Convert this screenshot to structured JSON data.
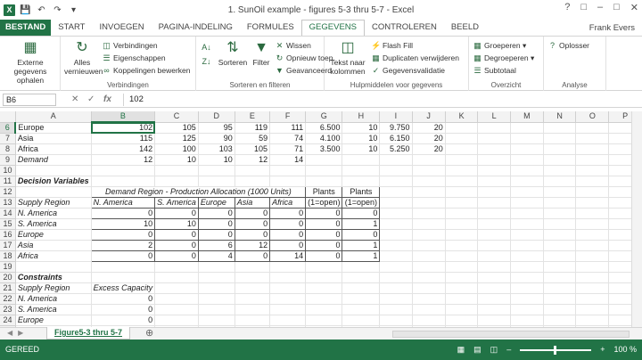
{
  "window": {
    "title": "1. SunOil example - figures 5-3 thru 5-7 - Excel",
    "app_icon": "X",
    "user": "Frank Evers",
    "colors": {
      "brand": "#217346"
    }
  },
  "ribbon_tabs": [
    "BESTAND",
    "START",
    "INVOEGEN",
    "PAGINA-INDELING",
    "FORMULES",
    "GEGEVENS",
    "CONTROLEREN",
    "BEELD"
  ],
  "ribbon": {
    "external_data": "Externe gegevens ophalen",
    "refresh_all": "Alles vernieuwen",
    "connections": "Verbindingen",
    "properties": "Eigenschappen",
    "edit_links": "Koppelingen bewerken",
    "group_connections": "Verbindingen",
    "sort": "Sorteren",
    "filter": "Filter",
    "clear": "Wissen",
    "reapply": "Opnieuw toep.",
    "advanced": "Geavanceerd",
    "group_sort": "Sorteren en filteren",
    "text_to_columns": "Tekst naar kolommen",
    "flash_fill": "Flash Fill",
    "remove_duplicates": "Duplicaten verwijderen",
    "data_validation": "Gegevensvalidatie",
    "group_tools": "Hulpmiddelen voor gegevens",
    "group": "Groeperen",
    "ungroup": "Degroeperen",
    "subtotal": "Subtotaal",
    "group_outline": "Overzicht",
    "solver": "Oplosser",
    "group_analysis": "Analyse"
  },
  "formula_bar": {
    "name_box": "B6",
    "fx": "fx",
    "formula": "102"
  },
  "columns": [
    "A",
    "B",
    "C",
    "D",
    "E",
    "F",
    "G",
    "H",
    "I",
    "J",
    "K",
    "L",
    "M",
    "N",
    "O",
    "P"
  ],
  "rows": [
    {
      "n": "6",
      "cells": [
        "Europe",
        "102",
        "105",
        "95",
        "119",
        "111",
        "6.500",
        "10",
        "9.750",
        "20"
      ]
    },
    {
      "n": "7",
      "cells": [
        "Asia",
        "115",
        "125",
        "90",
        "59",
        "74",
        "4.100",
        "10",
        "6.150",
        "20"
      ]
    },
    {
      "n": "8",
      "cells": [
        "Africa",
        "142",
        "100",
        "103",
        "105",
        "71",
        "3.500",
        "10",
        "5.250",
        "20"
      ]
    },
    {
      "n": "9",
      "cells": [
        "Demand",
        "12",
        "10",
        "10",
        "12",
        "14",
        "",
        "",
        "",
        ""
      ]
    },
    {
      "n": "10",
      "cells": [
        "",
        "",
        "",
        "",
        "",
        "",
        "",
        "",
        "",
        ""
      ]
    },
    {
      "n": "11",
      "cells": [
        "Decision Variables",
        "",
        "",
        "",
        "",
        "",
        "",
        "",
        "",
        ""
      ]
    },
    {
      "n": "12",
      "cells": [
        "",
        "Demand Region - Production Allocation (1000 Units)",
        "",
        "",
        "",
        "",
        "Plants",
        "Plants",
        "",
        ""
      ]
    },
    {
      "n": "13",
      "cells": [
        "Supply Region",
        "N. America",
        "S. America",
        "Europe",
        "Asia",
        "Africa",
        "(1=open)",
        "(1=open)",
        "",
        ""
      ]
    },
    {
      "n": "14",
      "cells": [
        "N. America",
        "0",
        "0",
        "0",
        "0",
        "0",
        "0",
        "0",
        "",
        ""
      ]
    },
    {
      "n": "15",
      "cells": [
        "S. America",
        "10",
        "10",
        "0",
        "0",
        "0",
        "0",
        "1",
        "",
        ""
      ]
    },
    {
      "n": "16",
      "cells": [
        "Europe",
        "0",
        "0",
        "0",
        "0",
        "0",
        "0",
        "0",
        "",
        ""
      ]
    },
    {
      "n": "17",
      "cells": [
        "Asia",
        "2",
        "0",
        "6",
        "12",
        "0",
        "0",
        "1",
        "",
        ""
      ]
    },
    {
      "n": "18",
      "cells": [
        "Africa",
        "0",
        "0",
        "4",
        "0",
        "14",
        "0",
        "1",
        "",
        ""
      ]
    },
    {
      "n": "19",
      "cells": [
        "",
        "",
        "",
        "",
        "",
        "",
        "",
        "",
        "",
        ""
      ]
    },
    {
      "n": "20",
      "cells": [
        "Constraints",
        "",
        "",
        "",
        "",
        "",
        "",
        "",
        "",
        ""
      ]
    },
    {
      "n": "21",
      "cells": [
        "Supply Region",
        "Excess Capacity",
        "",
        "",
        "",
        "",
        "",
        "",
        "",
        ""
      ]
    },
    {
      "n": "22",
      "cells": [
        "N. America",
        "0",
        "",
        "",
        "",
        "",
        "",
        "",
        "",
        ""
      ]
    },
    {
      "n": "23",
      "cells": [
        "S. America",
        "0",
        "",
        "",
        "",
        "",
        "",
        "",
        "",
        ""
      ]
    },
    {
      "n": "24",
      "cells": [
        "Europe",
        "0",
        "",
        "",
        "",
        "",
        "",
        "",
        "",
        ""
      ]
    },
    {
      "n": "25",
      "cells": [
        "Asia",
        "0",
        "",
        "",
        "",
        "",
        "",
        "",
        "",
        ""
      ]
    }
  ],
  "sheet_tab": "Figure5-3 thru 5-7",
  "status": {
    "ready": "GEREED",
    "zoom": "100 %"
  }
}
